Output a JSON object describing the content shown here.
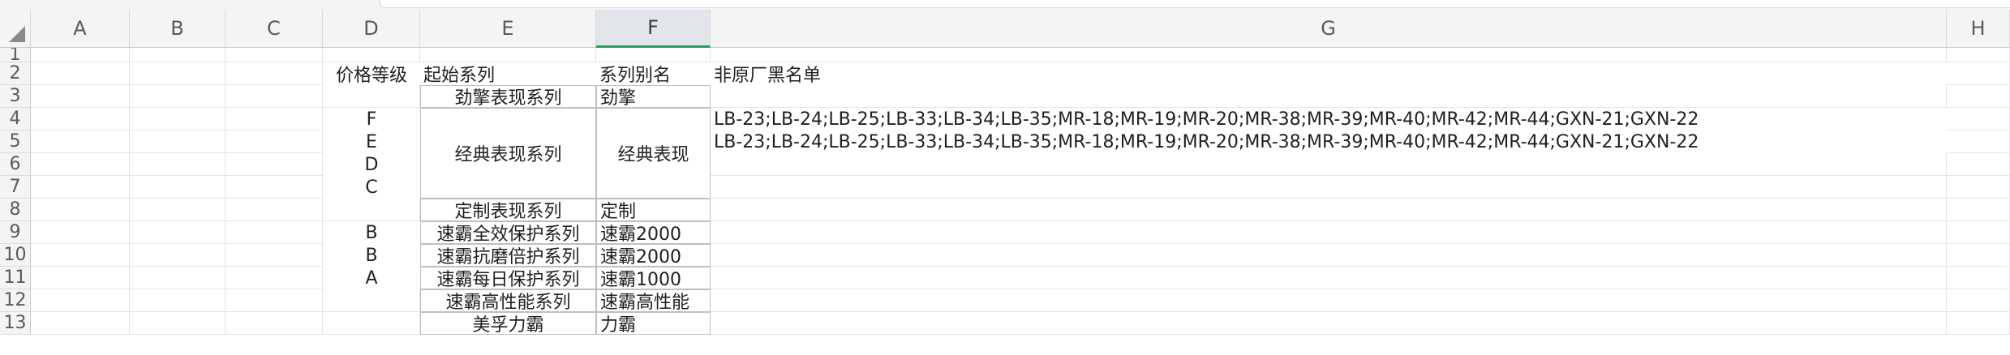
{
  "columns": [
    "A",
    "B",
    "C",
    "D",
    "E",
    "F",
    "G",
    "H"
  ],
  "rows": [
    "1",
    "2",
    "3",
    "4",
    "5",
    "6",
    "7",
    "8",
    "9",
    "10",
    "11",
    "12",
    "13"
  ],
  "selected_column": "F",
  "cells": {
    "D2": "价格等级",
    "E2": "起始系列",
    "F2": "系列别名",
    "G2": "非原厂黑名单",
    "E3": "劲擎表现系列",
    "F3": "劲擎",
    "D4": "F",
    "G4": "LB-23;LB-24;LB-25;LB-33;LB-34;LB-35;MR-18;MR-19;MR-20;MR-38;MR-39;MR-40;MR-42;MR-44;GXN-21;GXN-22",
    "D5": "E",
    "G5": "LB-23;LB-24;LB-25;LB-33;LB-34;LB-35;MR-18;MR-19;MR-20;MR-38;MR-39;MR-40;MR-42;MR-44;GXN-21;GXN-22",
    "D6": "D",
    "D7": "C",
    "E4": "经典表现系列",
    "F4": "经典表现",
    "E8": "定制表现系列",
    "F8": "定制",
    "D9": "B",
    "E9": "速霸全效保护系列",
    "F9": "速霸2000",
    "D10": "B",
    "E10": "速霸抗磨倍护系列",
    "F10": "速霸2000",
    "D11": "A",
    "E11": "速霸每日保护系列",
    "F11": "速霸1000",
    "E12": "速霸高性能系列",
    "F12": "速霸高性能",
    "E13": "美孚力霸",
    "F13": "力霸"
  },
  "colors": {
    "header_bg": "#f4f4f4",
    "selected_header_bg": "#e2e6ea",
    "selected_accent": "#20a162",
    "grid": "#e1e4ec",
    "cell_border": "#bfbfbf"
  }
}
